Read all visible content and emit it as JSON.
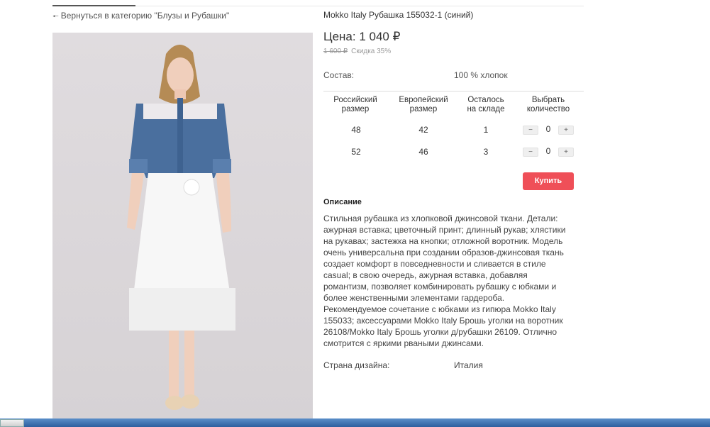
{
  "nav": {
    "back_link": "Вернуться в категорию \"Блузы и Рубашки\""
  },
  "product": {
    "title": "Mokko Italy Рубашка 155032-1 (синий)",
    "price": "Цена: 1 040 ₽",
    "old_price": "1 600 ₽",
    "discount": "Скидка 35%",
    "composition_label": "Состав:",
    "composition_value": "100 % хлопок",
    "country_label": "Страна дизайна:",
    "country_value": "Италия"
  },
  "sizes_table": {
    "headers": [
      [
        "Российский",
        "размер"
      ],
      [
        "Европейский",
        "размер"
      ],
      [
        "Осталось",
        "на складе"
      ],
      [
        "Выбрать",
        "количество"
      ]
    ],
    "rows": [
      {
        "ru": "48",
        "eu": "42",
        "stock": "1",
        "qty": "0"
      },
      {
        "ru": "52",
        "eu": "46",
        "stock": "3",
        "qty": "0"
      }
    ],
    "minus": "−",
    "plus": "+"
  },
  "buy_button": "Купить",
  "description": {
    "title": "Описание",
    "paragraph1": "Стильная рубашка из хлопковой джинсовой ткани. Детали: ажурная вставка; цветочный принт; длинный рукав; хлястики на рукавах; застежка на кнопки; отложной воротник. Модель очень универсальна при создании образов-джинсовая ткань создает комфорт в повседневности и сливается в стиле casual; в свою очередь, ажурная вставка, добавляя романтизм, позволяет комбинировать рубашку с юбками и более женственными элементами гардероба.",
    "paragraph2": "Рекомендуемое сочетание с юбками из гипюра Mokko Italy 155033; аксессуарами Mokko Italy Брошь уголки на воротник 26108/Mokko Italy Брошь уголки д/рубашки 26109. Отлично смотрится с яркими рваными джинсами."
  },
  "colors": {
    "buy": "#ef4f58",
    "shirt": "#4a6f9e"
  }
}
